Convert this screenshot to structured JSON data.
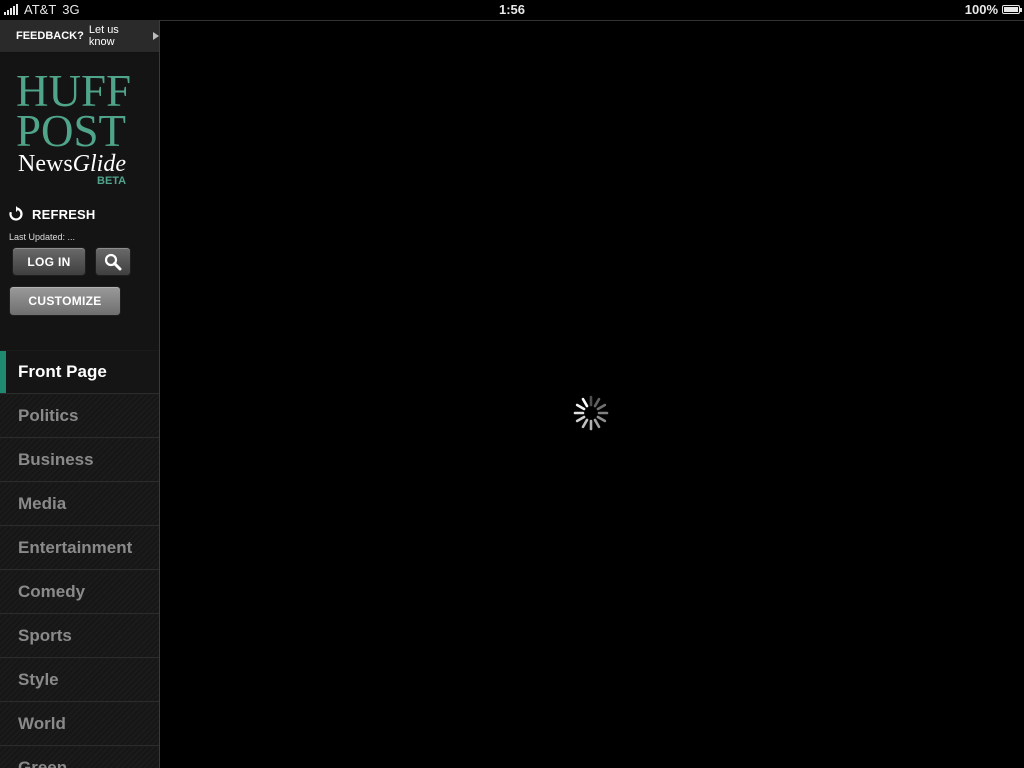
{
  "status_bar": {
    "carrier": "AT&T",
    "network": "3G",
    "time": "1:56",
    "battery": "100%"
  },
  "sidebar": {
    "feedback": {
      "strong": "FEEDBACK?",
      "link": "Let us know"
    },
    "logo": {
      "line1": "HUFF",
      "line2": "POST",
      "news": "News",
      "glide": "Glide",
      "beta": "BETA"
    },
    "refresh_label": "REFRESH",
    "last_updated": "Last Updated: ...",
    "login_label": "LOG IN",
    "customize_label": "CUSTOMIZE",
    "nav": [
      {
        "label": "Front Page",
        "active": true
      },
      {
        "label": "Politics"
      },
      {
        "label": "Business"
      },
      {
        "label": "Media"
      },
      {
        "label": "Entertainment"
      },
      {
        "label": "Comedy"
      },
      {
        "label": "Sports"
      },
      {
        "label": "Style"
      },
      {
        "label": "World"
      },
      {
        "label": "Green"
      }
    ]
  },
  "colors": {
    "brand": "#4fa48a",
    "active_accent": "#1f8a70"
  }
}
